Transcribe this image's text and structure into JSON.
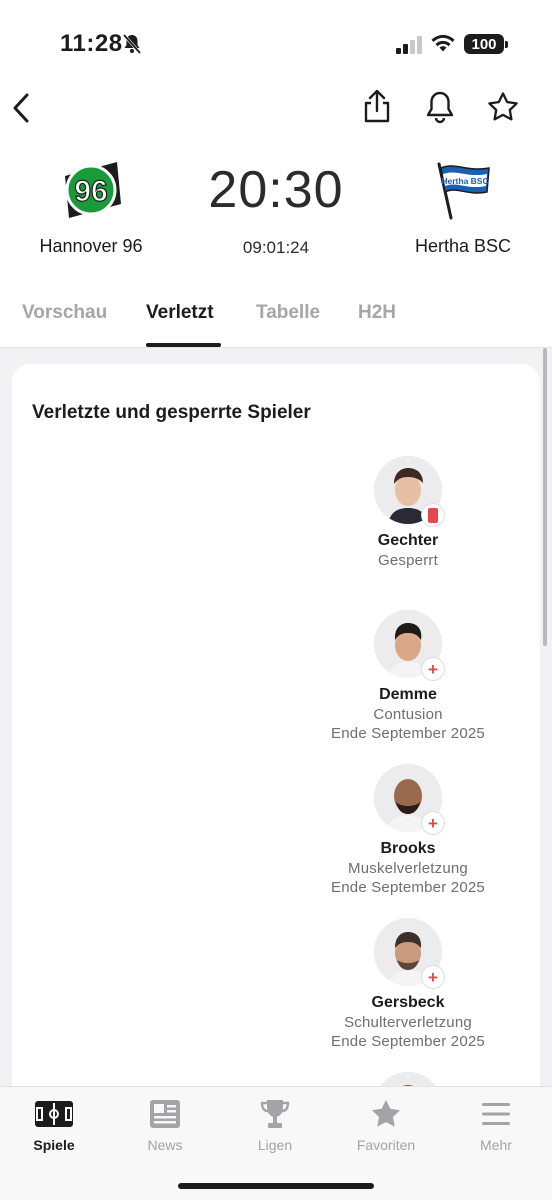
{
  "status_bar": {
    "time": "11:28",
    "battery": "100"
  },
  "match": {
    "home_team": "Hannover 96",
    "away_team": "Hertha BSC",
    "away_logo_text": "Hertha BSC",
    "kickoff_time": "20:30",
    "countdown": "09:01:24"
  },
  "tabs": [
    {
      "label": "Vorschau",
      "active": false
    },
    {
      "label": "Verletzt",
      "active": true
    },
    {
      "label": "Tabelle",
      "active": false
    },
    {
      "label": "H2H",
      "active": false
    }
  ],
  "section_title": "Verletzte und gesperrte Spieler",
  "players": [
    {
      "name": "Gechter",
      "reason": "Gesperrt",
      "until": "",
      "status": "suspended"
    },
    {
      "name": "Demme",
      "reason": "Contusion",
      "until": "Ende September 2025",
      "status": "injured"
    },
    {
      "name": "Brooks",
      "reason": "Muskelverletzung",
      "until": "Ende September 2025",
      "status": "injured"
    },
    {
      "name": "Gersbeck",
      "reason": "Schulterverletzung",
      "until": "Ende September 2025",
      "status": "injured"
    }
  ],
  "bottom_nav": [
    {
      "label": "Spiele",
      "icon": "pitch-icon",
      "active": true
    },
    {
      "label": "News",
      "icon": "news-icon",
      "active": false
    },
    {
      "label": "Ligen",
      "icon": "trophy-icon",
      "active": false
    },
    {
      "label": "Favoriten",
      "icon": "star-icon",
      "active": false
    },
    {
      "label": "Mehr",
      "icon": "menu-icon",
      "active": false
    }
  ],
  "colors": {
    "accent": "#1c1c1e",
    "inactive": "#a3a3a8",
    "red": "#e04a4a",
    "hannover_green": "#1a9b3a",
    "hertha_blue": "#1b5fb5"
  }
}
